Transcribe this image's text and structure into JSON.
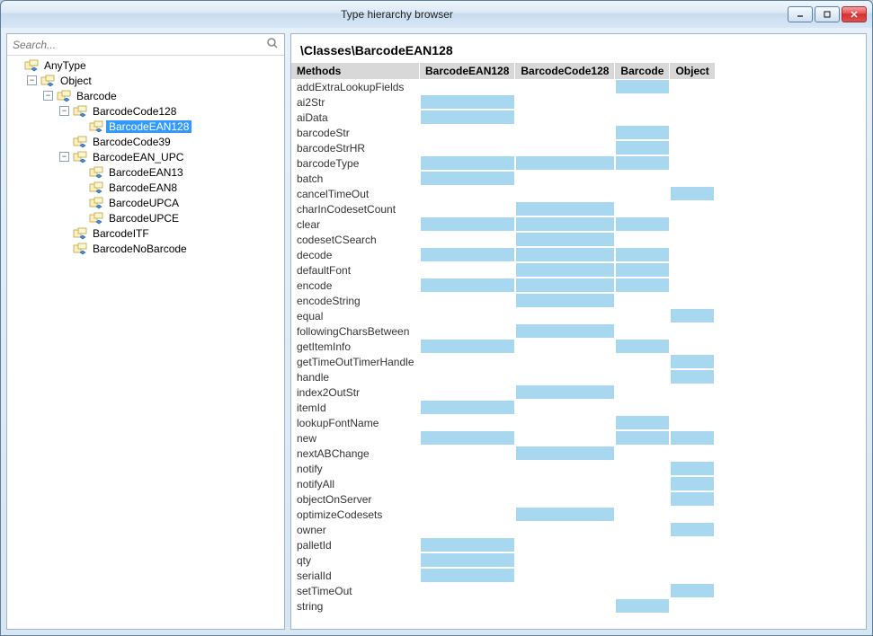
{
  "window": {
    "title": "Type hierarchy browser"
  },
  "search": {
    "placeholder": "Search..."
  },
  "tree": [
    {
      "level": 0,
      "toggle": "none",
      "icon": "class",
      "label": "AnyType",
      "selected": false
    },
    {
      "level": 1,
      "toggle": "minus",
      "icon": "class",
      "label": "Object",
      "selected": false
    },
    {
      "level": 2,
      "toggle": "minus",
      "icon": "class",
      "label": "Barcode",
      "selected": false
    },
    {
      "level": 3,
      "toggle": "minus",
      "icon": "class",
      "label": "BarcodeCode128",
      "selected": false
    },
    {
      "level": 4,
      "toggle": "none",
      "icon": "class",
      "label": "BarcodeEAN128",
      "selected": true
    },
    {
      "level": 3,
      "toggle": "none",
      "icon": "class",
      "label": "BarcodeCode39",
      "selected": false
    },
    {
      "level": 3,
      "toggle": "minus",
      "icon": "class",
      "label": "BarcodeEAN_UPC",
      "selected": false
    },
    {
      "level": 4,
      "toggle": "none",
      "icon": "class",
      "label": "BarcodeEAN13",
      "selected": false
    },
    {
      "level": 4,
      "toggle": "none",
      "icon": "class",
      "label": "BarcodeEAN8",
      "selected": false
    },
    {
      "level": 4,
      "toggle": "none",
      "icon": "class",
      "label": "BarcodeUPCA",
      "selected": false
    },
    {
      "level": 4,
      "toggle": "none",
      "icon": "class",
      "label": "BarcodeUPCE",
      "selected": false
    },
    {
      "level": 3,
      "toggle": "none",
      "icon": "class",
      "label": "BarcodeITF",
      "selected": false
    },
    {
      "level": 3,
      "toggle": "none",
      "icon": "class",
      "label": "BarcodeNoBarcode",
      "selected": false
    }
  ],
  "breadcrumb": "\\Classes\\BarcodeEAN128",
  "grid": {
    "columns": [
      "Methods",
      "BarcodeEAN128",
      "BarcodeCode128",
      "Barcode",
      "Object"
    ],
    "rows": [
      {
        "m": "addExtraLookupFields",
        "c": [
          0,
          0,
          1,
          0
        ]
      },
      {
        "m": "ai2Str",
        "c": [
          1,
          0,
          0,
          0
        ]
      },
      {
        "m": "aiData",
        "c": [
          1,
          0,
          0,
          0
        ]
      },
      {
        "m": "barcodeStr",
        "c": [
          0,
          0,
          1,
          0
        ]
      },
      {
        "m": "barcodeStrHR",
        "c": [
          0,
          0,
          1,
          0
        ]
      },
      {
        "m": "barcodeType",
        "c": [
          1,
          1,
          1,
          0
        ]
      },
      {
        "m": "batch",
        "c": [
          1,
          0,
          0,
          0
        ]
      },
      {
        "m": "cancelTimeOut",
        "c": [
          0,
          0,
          0,
          1
        ]
      },
      {
        "m": "charInCodesetCount",
        "c": [
          0,
          1,
          0,
          0
        ]
      },
      {
        "m": "clear",
        "c": [
          1,
          1,
          1,
          0
        ]
      },
      {
        "m": "codesetCSearch",
        "c": [
          0,
          1,
          0,
          0
        ]
      },
      {
        "m": "decode",
        "c": [
          1,
          1,
          1,
          0
        ]
      },
      {
        "m": "defaultFont",
        "c": [
          0,
          1,
          1,
          0
        ]
      },
      {
        "m": "encode",
        "c": [
          1,
          1,
          1,
          0
        ]
      },
      {
        "m": "encodeString",
        "c": [
          0,
          1,
          0,
          0
        ]
      },
      {
        "m": "equal",
        "c": [
          0,
          0,
          0,
          1
        ]
      },
      {
        "m": "followingCharsBetween",
        "c": [
          0,
          1,
          0,
          0
        ]
      },
      {
        "m": "getItemInfo",
        "c": [
          1,
          0,
          1,
          0
        ]
      },
      {
        "m": "getTimeOutTimerHandle",
        "c": [
          0,
          0,
          0,
          1
        ]
      },
      {
        "m": "handle",
        "c": [
          0,
          0,
          0,
          1
        ]
      },
      {
        "m": "index2OutStr",
        "c": [
          0,
          1,
          0,
          0
        ]
      },
      {
        "m": "itemId",
        "c": [
          1,
          0,
          0,
          0
        ]
      },
      {
        "m": "lookupFontName",
        "c": [
          0,
          0,
          1,
          0
        ]
      },
      {
        "m": "new",
        "c": [
          1,
          0,
          1,
          1
        ]
      },
      {
        "m": "nextABChange",
        "c": [
          0,
          1,
          0,
          0
        ]
      },
      {
        "m": "notify",
        "c": [
          0,
          0,
          0,
          1
        ]
      },
      {
        "m": "notifyAll",
        "c": [
          0,
          0,
          0,
          1
        ]
      },
      {
        "m": "objectOnServer",
        "c": [
          0,
          0,
          0,
          1
        ]
      },
      {
        "m": "optimizeCodesets",
        "c": [
          0,
          1,
          0,
          0
        ]
      },
      {
        "m": "owner",
        "c": [
          0,
          0,
          0,
          1
        ]
      },
      {
        "m": "palletId",
        "c": [
          1,
          0,
          0,
          0
        ]
      },
      {
        "m": "qty",
        "c": [
          1,
          0,
          0,
          0
        ]
      },
      {
        "m": "serialId",
        "c": [
          1,
          0,
          0,
          0
        ]
      },
      {
        "m": "setTimeOut",
        "c": [
          0,
          0,
          0,
          1
        ]
      },
      {
        "m": "string",
        "c": [
          0,
          0,
          1,
          0
        ]
      }
    ]
  },
  "colors": {
    "highlight": "#a8d8f0",
    "selection": "#3399ff"
  }
}
